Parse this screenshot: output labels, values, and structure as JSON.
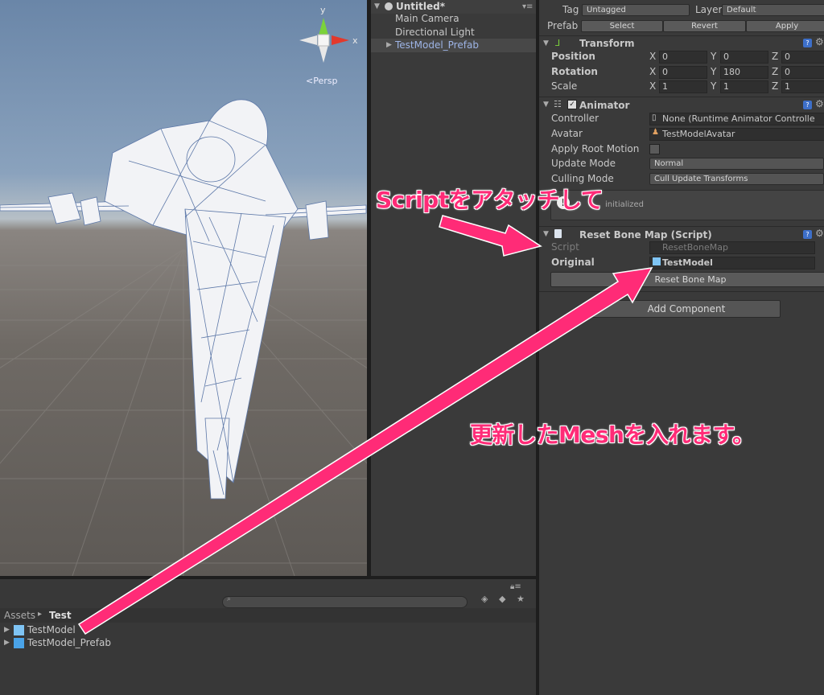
{
  "scene": {
    "view_mode": "<Persp",
    "gizmo_y": "y",
    "gizmo_x": "x"
  },
  "hierarchy": {
    "scene_name": "Untitled*",
    "items": [
      {
        "label": "Main Camera"
      },
      {
        "label": "Directional Light"
      },
      {
        "label": "TestModel_Prefab"
      }
    ]
  },
  "inspector": {
    "tag_label": "Tag",
    "tag_value": "Untagged",
    "layer_label": "Layer",
    "layer_value": "Default",
    "prefab_label": "Prefab",
    "prefab_buttons": [
      "Select",
      "Revert",
      "Apply"
    ],
    "transform": {
      "title": "Transform",
      "rows": [
        {
          "label": "Position",
          "x": "0",
          "y": "0",
          "z": "0"
        },
        {
          "label": "Rotation",
          "x": "0",
          "y": "180",
          "z": "0"
        },
        {
          "label": "Scale",
          "x": "1",
          "y": "1",
          "z": "1"
        }
      ],
      "axis_labels": [
        "X",
        "Y",
        "Z"
      ]
    },
    "animator": {
      "title": "Animator",
      "controller_label": "Controller",
      "controller_value": "None (Runtime Animator Controlle",
      "avatar_label": "Avatar",
      "avatar_value": "TestModelAvatar",
      "root_motion_label": "Apply Root Motion",
      "update_mode_label": "Update Mode",
      "update_mode_value": "Normal",
      "culling_mode_label": "Culling Mode",
      "culling_mode_value": "Cull Update Transforms",
      "info_text": "initialized"
    },
    "reset_bone_map": {
      "title": "Reset Bone Map (Script)",
      "script_label": "Script",
      "script_value": "ResetBoneMap",
      "original_label": "Original",
      "original_value": "TestModel",
      "button_label": "Reset Bone Map"
    },
    "add_component_label": "Add Component"
  },
  "project": {
    "breadcrumb_root": "Assets",
    "breadcrumb_sep": "▸",
    "breadcrumb_current": "Test",
    "items": [
      {
        "label": "TestModel"
      },
      {
        "label": "TestModel_Prefab"
      }
    ]
  },
  "annotations": {
    "attach_script": "Scriptをアタッチして",
    "put_mesh": "更新したMeshを入れます。"
  },
  "colors": {
    "accent_pink": "#ff2b77",
    "prefab_blue": "#9db4e6",
    "panel_bg": "#3a3a3a"
  }
}
